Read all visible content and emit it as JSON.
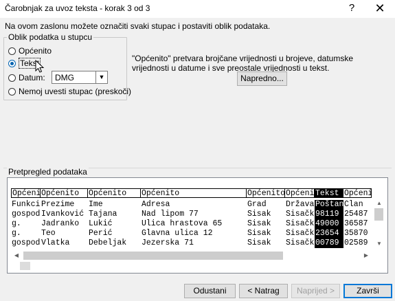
{
  "window": {
    "title": "Čarobnjak za uvoz teksta - korak 3 od 3",
    "help_glyph": "?",
    "close_glyph": "✕"
  },
  "description": "Na ovom zaslonu možete označiti svaki stupac i postaviti oblik podataka.",
  "column_format": {
    "group_label": "Oblik podatka u stupcu",
    "options": [
      {
        "label": "Općenito",
        "checked": false
      },
      {
        "label": "Tekst",
        "checked": true
      },
      {
        "label": "Datum:",
        "checked": false
      },
      {
        "label": "Nemoj uvesti stupac (preskoči)",
        "checked": false
      }
    ],
    "date_select_value": "DMG"
  },
  "info_text": "\"Općenito\" pretvara brojčane vrijednosti u brojeve, datumske vrijednosti u datume i sve preostale vrijednosti u tekst.",
  "advanced_button": "Napredno...",
  "preview": {
    "label": "Pretpregled podataka",
    "headers": [
      "Općenito",
      "Općenito",
      "Općenito",
      "Općenito",
      "Općenito",
      "Općenito",
      "Tekst",
      "Općenito"
    ],
    "rows": [
      [
        "Funkcija",
        "Prezime",
        "Ime",
        "Adresa",
        "Grad",
        "Država",
        "Poštanski",
        "Član"
      ],
      [
        "gospodin",
        "Ivanković",
        "Tajana",
        "Nad lipom 77",
        "Sisak",
        "Sisačko",
        "98119",
        "25487"
      ],
      [
        "g.",
        "Jadranko",
        "Lukić",
        "Ulica hrastova 65",
        "Sisak",
        "Sisačko",
        "49000",
        "36587"
      ],
      [
        "g.",
        "Teo",
        "Perić",
        "Glavna ulica 12",
        "Sisak",
        "Sisačko",
        "23654",
        "35870"
      ],
      [
        "gospodin",
        "Vlatka",
        "Debeljak",
        "Jezerska 71",
        "Sisak",
        "Sisačko",
        "00789",
        "02589"
      ]
    ],
    "selected_column": 6
  },
  "buttons": {
    "cancel": "Odustani",
    "back": "< Natrag",
    "next": "Naprijed >",
    "finish": "Završi"
  },
  "colors": {
    "accent": "#0078d7",
    "selection": "#000000"
  }
}
